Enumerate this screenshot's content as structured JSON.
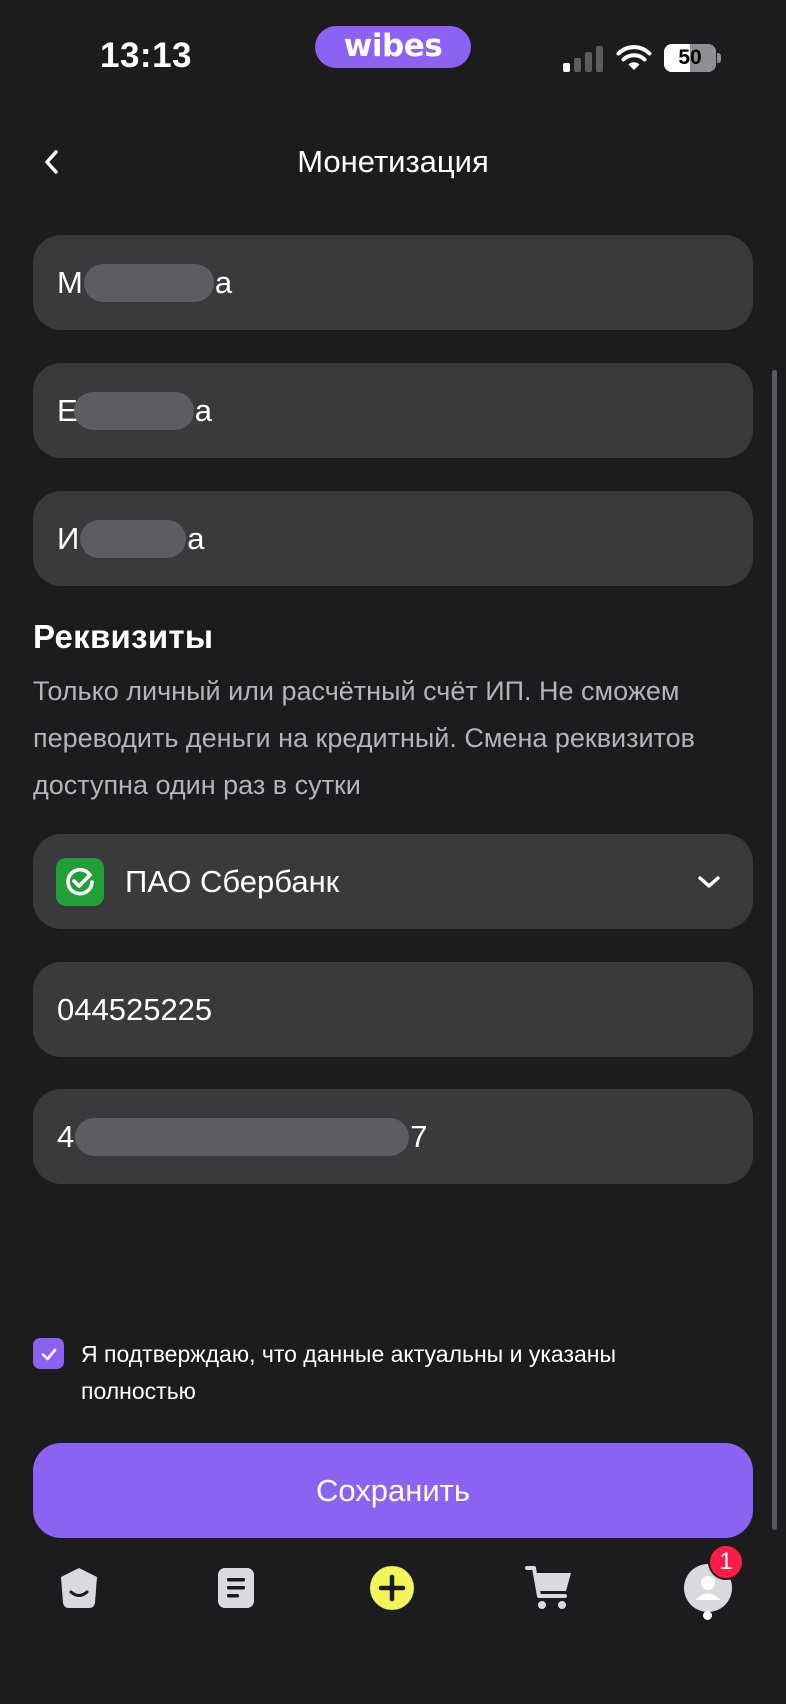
{
  "status_bar": {
    "time": "13:13",
    "brand": "wibes",
    "battery_percent": "50",
    "battery_level": 0.5,
    "signal_bars_active": 1,
    "signal_bars_total": 4
  },
  "header": {
    "title": "Монетизация",
    "back_icon": "chevron-left-icon"
  },
  "personal": {
    "last_name": {
      "prefix": "М",
      "suffix": "а"
    },
    "first_name": {
      "prefix": "Е",
      "suffix": "а"
    },
    "middle_name": {
      "prefix": "И",
      "suffix": "а"
    }
  },
  "requisites": {
    "title": "Реквизиты",
    "description": "Только личный или расчётный счёт ИП. Не сможем переводить деньги на кредитный. Смена реквизитов доступна один раз в сутки",
    "bank": {
      "name": "ПАО Сбербанк",
      "logo_icon": "sberbank-logo-icon",
      "chevron_icon": "chevron-down-icon"
    },
    "bik": "044525225",
    "account": {
      "prefix": "4",
      "suffix": "7"
    }
  },
  "confirm": {
    "checked": true,
    "text": "Я подтверждаю, что данные актуальны и указаны полностью"
  },
  "save_label": "Сохранить",
  "tab_bar": {
    "items": [
      {
        "icon": "home-face-icon"
      },
      {
        "icon": "document-list-icon"
      },
      {
        "icon": "plus-circle-icon"
      },
      {
        "icon": "cart-icon"
      },
      {
        "icon": "profile-avatar-icon"
      }
    ],
    "profile_badge": "1"
  },
  "colors": {
    "background": "#1c1c1e",
    "field": "#3a3a3c",
    "accent": "#8b62f2",
    "plus_button": "#f2f55a",
    "badge": "#ff1d48",
    "sber_green": "#21a038"
  }
}
